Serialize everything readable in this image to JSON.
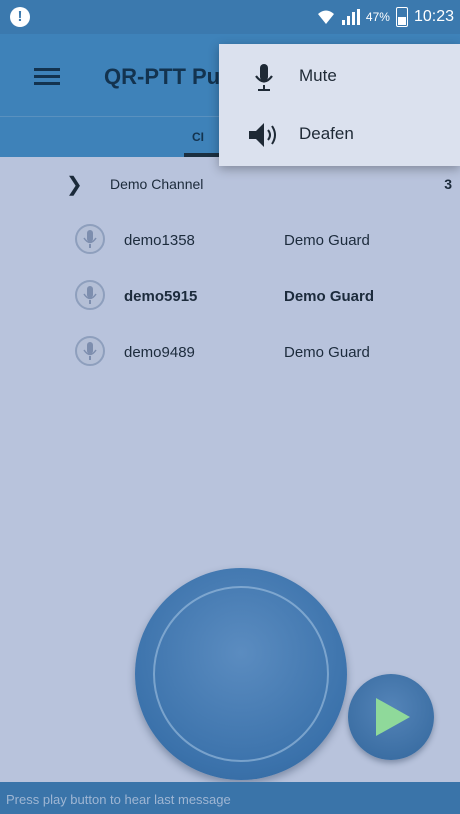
{
  "status_bar": {
    "alert_glyph": "!",
    "battery": "47%",
    "time": "10:23"
  },
  "app_bar": {
    "title": "QR-PTT Pu",
    "tab_label": "CI"
  },
  "overflow_menu": {
    "items": [
      {
        "label": "Mute",
        "icon": "microphone-icon"
      },
      {
        "label": "Deafen",
        "icon": "speaker-icon"
      }
    ]
  },
  "channel": {
    "chevron": "❯",
    "name": "Demo Channel",
    "count": "3"
  },
  "users": [
    {
      "name": "demo1358",
      "group": "Demo Guard",
      "bold": false
    },
    {
      "name": "demo5915",
      "group": "Demo Guard",
      "bold": true
    },
    {
      "name": "demo9489",
      "group": "Demo Guard",
      "bold": false
    }
  ],
  "bottom_bar": {
    "text": "Press play button to hear last message"
  },
  "colors": {
    "app_bar": "#3e82b9",
    "background": "#b8c3dc",
    "play_icon": "#8fd99a"
  }
}
